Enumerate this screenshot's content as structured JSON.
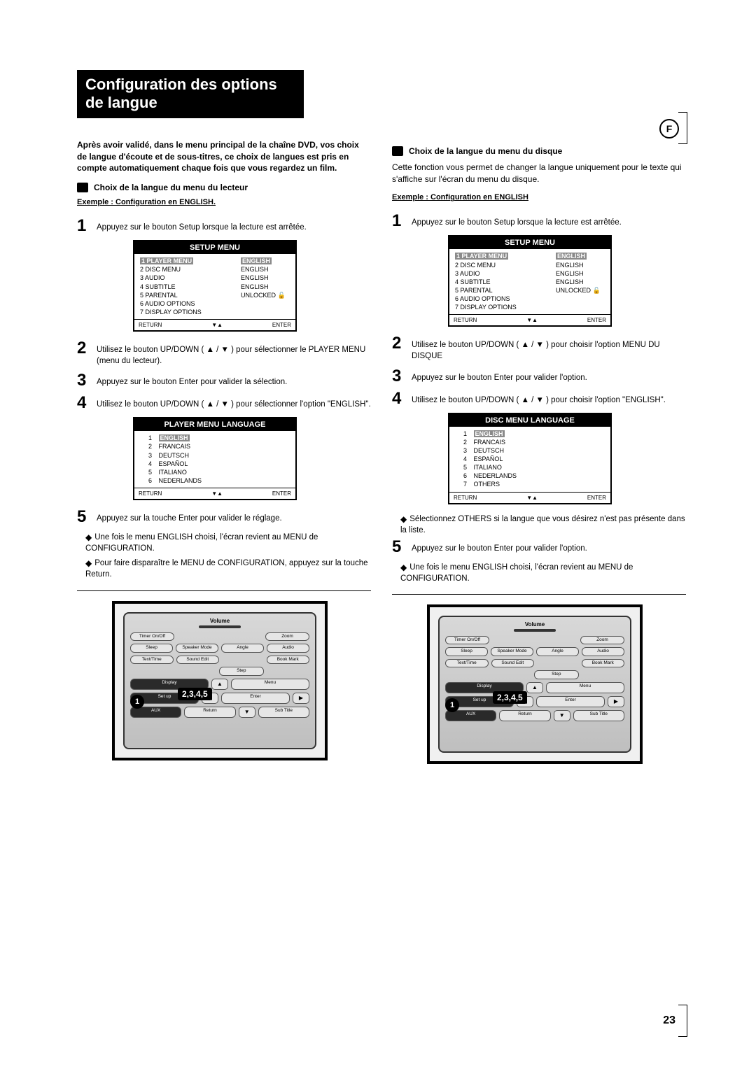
{
  "page_number": "23",
  "lang_badge": "F",
  "title": "Configuration des options de langue",
  "left": {
    "intro": "Après avoir validé, dans le menu principal de la chaîne DVD, vos choix de langue d'écoute et de sous-titres, ce choix de langues est pris en compte automatiquement chaque fois que vous regardez un film.",
    "sub_head": "Choix de la langue du menu du lecteur",
    "example": "Exemple : Configuration en ENGLISH.",
    "step1": "Appuyez sur le bouton Setup lorsque la lecture est arrêtée.",
    "setup_title": "SETUP MENU",
    "setup_items": [
      {
        "n": "1",
        "l": "PLAYER MENU",
        "r": "ENGLISH",
        "sel": true
      },
      {
        "n": "2",
        "l": "DISC MENU",
        "r": "ENGLISH"
      },
      {
        "n": "3",
        "l": "AUDIO",
        "r": "ENGLISH"
      },
      {
        "n": "4",
        "l": "SUBTITLE",
        "r": "ENGLISH"
      },
      {
        "n": "5",
        "l": "PARENTAL",
        "r": "UNLOCKED 🔓"
      },
      {
        "n": "6",
        "l": "AUDIO OPTIONS",
        "r": ""
      },
      {
        "n": "7",
        "l": "DISPLAY OPTIONS",
        "r": ""
      }
    ],
    "footer_return": "RETURN",
    "footer_enter": "ENTER",
    "step2": "Utilisez le bouton UP/DOWN ( ▲ / ▼ ) pour sélectionner le PLAYER MENU (menu du lecteur).",
    "step3": "Appuyez sur le bouton Enter pour valider la sélection.",
    "step4": "Utilisez le bouton UP/DOWN ( ▲ / ▼ ) pour sélectionner l'option \"ENGLISH\".",
    "lang_title": "PLAYER MENU LANGUAGE",
    "lang_items": [
      {
        "n": "1",
        "l": "ENGLISH",
        "sel": true
      },
      {
        "n": "2",
        "l": "FRANCAIS"
      },
      {
        "n": "3",
        "l": "DEUTSCH"
      },
      {
        "n": "4",
        "l": "ESPAÑOL"
      },
      {
        "n": "5",
        "l": "ITALIANO"
      },
      {
        "n": "6",
        "l": "NEDERLANDS"
      }
    ],
    "step5": "Appuyez sur la touche Enter pour valider le réglage.",
    "note1": "Une fois le menu ENGLISH choisi, l'écran revient au MENU de CONFIGURATION.",
    "note2": "Pour faire disparaître le MENU de CONFIGURATION, appuyez sur la touche Return."
  },
  "right": {
    "sub_head": "Choix de la langue du menu du disque",
    "intro": "Cette fonction vous permet de changer la langue uniquement pour le texte qui s'affiche sur l'écran du menu du disque.",
    "example": "Exemple : Configuration en ENGLISH",
    "step1": "Appuyez sur le bouton Setup lorsque la lecture est arrêtée.",
    "setup_title": "SETUP MENU",
    "setup_items": [
      {
        "n": "1",
        "l": "PLAYER MENU",
        "r": "ENGLISH",
        "sel": true
      },
      {
        "n": "2",
        "l": "DISC MENU",
        "r": "ENGLISH"
      },
      {
        "n": "3",
        "l": "AUDIO",
        "r": "ENGLISH"
      },
      {
        "n": "4",
        "l": "SUBTITLE",
        "r": "ENGLISH"
      },
      {
        "n": "5",
        "l": "PARENTAL",
        "r": "UNLOCKED 🔓"
      },
      {
        "n": "6",
        "l": "AUDIO OPTIONS",
        "r": ""
      },
      {
        "n": "7",
        "l": "DISPLAY OPTIONS",
        "r": ""
      }
    ],
    "step2": "Utilisez le bouton UP/DOWN ( ▲ / ▼ ) pour choisir l'option MENU DU DISQUE",
    "step3": "Appuyez sur le bouton Enter pour valider l'option.",
    "step4": "Utilisez le bouton UP/DOWN ( ▲ / ▼ ) pour choisir l'option \"ENGLISH\".",
    "lang_title": "DISC MENU LANGUAGE",
    "lang_items": [
      {
        "n": "1",
        "l": "ENGLISH",
        "sel": true
      },
      {
        "n": "2",
        "l": "FRANCAIS"
      },
      {
        "n": "3",
        "l": "DEUTSCH"
      },
      {
        "n": "4",
        "l": "ESPAÑOL"
      },
      {
        "n": "5",
        "l": "ITALIANO"
      },
      {
        "n": "6",
        "l": "NEDERLANDS"
      },
      {
        "n": "7",
        "l": "OTHERS"
      }
    ],
    "noteA": "Sélectionnez OTHERS si la langue que vous désirez n'est pas présente dans la liste.",
    "step5": "Appuyez sur le bouton Enter pour valider l'option.",
    "noteB": "Une fois le menu ENGLISH choisi, l'écran revient au MENU de CONFIGURATION."
  },
  "remote": {
    "volume": "Volume",
    "row1": [
      "Timer On/Off",
      "",
      "",
      "Zoom"
    ],
    "row2": [
      "Sleep",
      "Speaker Mode",
      "Angle",
      "Audio"
    ],
    "row3": [
      "Text/Time",
      "Sound Edit",
      "",
      "Book Mark"
    ],
    "row4": [
      "",
      "",
      "Step",
      ""
    ],
    "display": "Display",
    "setup": "Set up",
    "menu": "Menu",
    "enter": "Enter",
    "aux": "AUX",
    "return": "Return",
    "subtitle": "Sub Title",
    "callout1": "1",
    "callout2": "2,3,4,5"
  }
}
